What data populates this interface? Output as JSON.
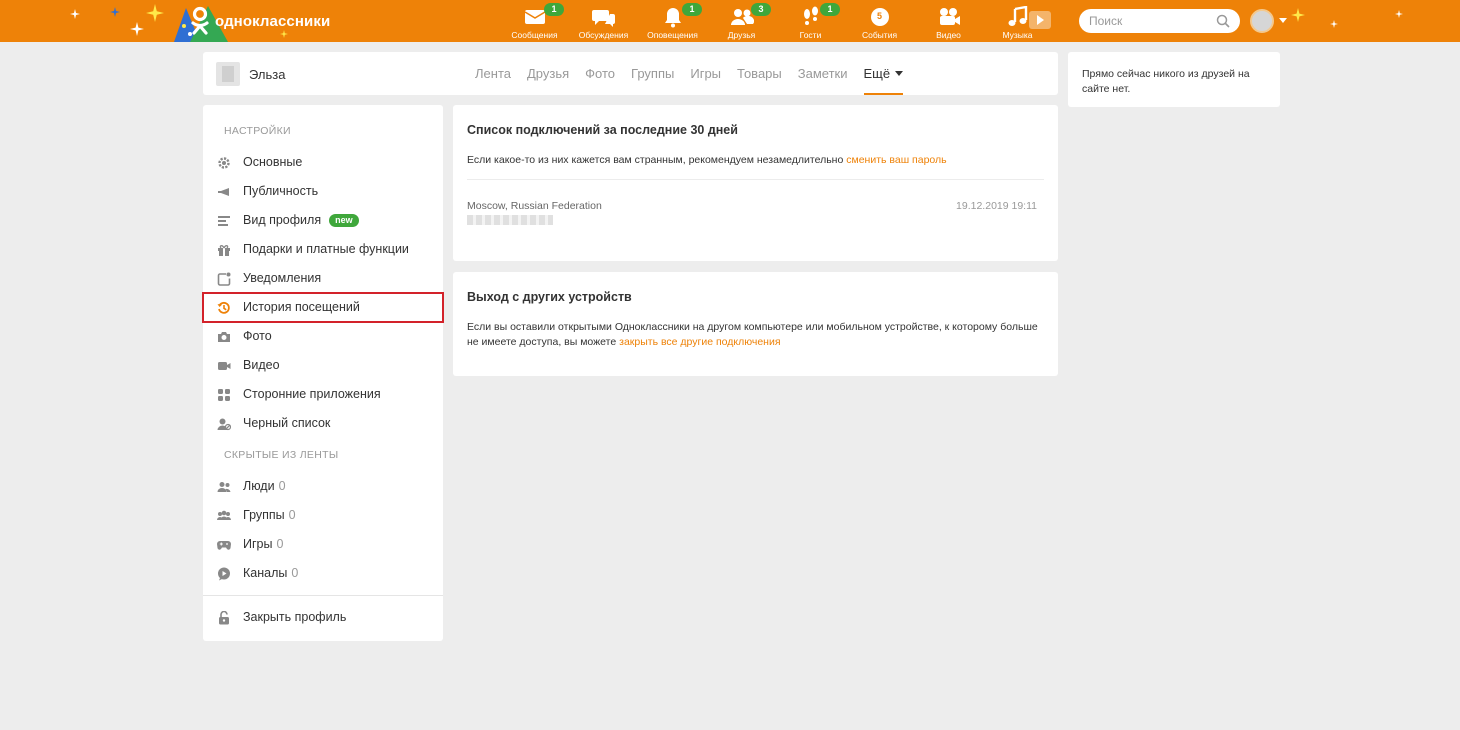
{
  "header": {
    "brand": "одноклассники",
    "nav": [
      {
        "label": "Сообщения",
        "icon": "envelope-icon",
        "count": "1"
      },
      {
        "label": "Обсуждения",
        "icon": "chat-bubbles-icon",
        "count": ""
      },
      {
        "label": "Оповещения",
        "icon": "bell-icon",
        "count": "1"
      },
      {
        "label": "Друзья",
        "icon": "friends-icon",
        "count": "3"
      },
      {
        "label": "Гости",
        "icon": "footprints-icon",
        "count": "1"
      },
      {
        "label": "События",
        "icon": "events-icon",
        "count": ""
      },
      {
        "label": "Видео",
        "icon": "video-camera-icon",
        "count": ""
      },
      {
        "label": "Музыка",
        "icon": "music-note-icon",
        "count": ""
      }
    ],
    "events_badge": "5",
    "search_placeholder": "Поиск"
  },
  "profile": {
    "name": "Эльза",
    "tabs": [
      "Лента",
      "Друзья",
      "Фото",
      "Группы",
      "Игры",
      "Товары",
      "Заметки",
      "Ещё"
    ],
    "active_tab": "Ещё"
  },
  "online": {
    "text": "Прямо сейчас никого из друзей на сайте нет."
  },
  "settings": {
    "section_title": "НАСТРОЙКИ",
    "items": [
      {
        "label": "Основные",
        "icon": "gear-icon"
      },
      {
        "label": "Публичность",
        "icon": "megaphone-icon"
      },
      {
        "label": "Вид профиля",
        "icon": "profile-lines-icon",
        "badge": "new"
      },
      {
        "label": "Подарки и платные функции",
        "icon": "gift-icon"
      },
      {
        "label": "Уведомления",
        "icon": "notification-icon"
      },
      {
        "label": "История посещений",
        "icon": "history-icon",
        "selected": true
      },
      {
        "label": "Фото",
        "icon": "camera-icon"
      },
      {
        "label": "Видео",
        "icon": "video-icon"
      },
      {
        "label": "Сторонние приложения",
        "icon": "apps-icon"
      },
      {
        "label": "Черный список",
        "icon": "blacklist-icon"
      }
    ],
    "hidden_title": "СКРЫТЫЕ ИЗ ЛЕНТЫ",
    "hidden_items": [
      {
        "label": "Люди",
        "count": "0",
        "icon": "people-icon"
      },
      {
        "label": "Группы",
        "count": "0",
        "icon": "groups-icon"
      },
      {
        "label": "Игры",
        "count": "0",
        "icon": "gamepad-icon"
      },
      {
        "label": "Каналы",
        "count": "0",
        "icon": "channels-icon"
      }
    ],
    "close_profile": "Закрыть профиль"
  },
  "connections": {
    "title": "Список подключений за последние 30 дней",
    "text": "Если какое-то из них кажется вам странным, рекомендуем незамедлительно",
    "link": "сменить ваш пароль",
    "location": "Moscow, Russian Federation",
    "datetime": "19.12.2019 19:11"
  },
  "logout": {
    "title": "Выход с других устройств",
    "text": "Если вы оставили открытыми Одноклассники на другом компьютере или мобильном устройстве, к которому больше не имеете доступа, вы можете",
    "link": "закрыть все другие подключения"
  },
  "colors": {
    "brand_orange": "#ee8208",
    "badge_green": "#3fa73b",
    "highlight_red": "#d3222a",
    "background": "#ededed"
  }
}
